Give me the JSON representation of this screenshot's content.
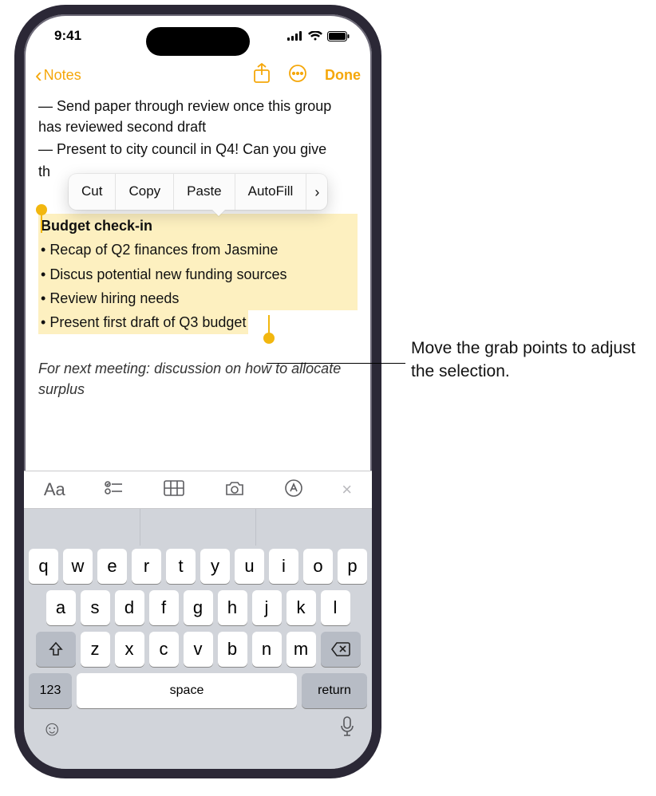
{
  "statusbar": {
    "time": "9:41"
  },
  "nav": {
    "back_label": "Notes",
    "done_label": "Done"
  },
  "note": {
    "line1": "— Send paper through review once this group has reviewed second draft",
    "line2_prefix": "— Present to city council in Q4! Can you give",
    "line2_rest": "th",
    "selection_title": "Budget check-in",
    "sel_items": [
      "Recap of Q2 finances from Jasmine",
      "Discus potential new funding sources",
      "Review hiring needs",
      "Present first draft of Q3 budget"
    ],
    "italic": "For next meeting: discussion on how to allocate surplus"
  },
  "editmenu": {
    "cut": "Cut",
    "copy": "Copy",
    "paste": "Paste",
    "autofill": "AutoFill"
  },
  "keyboard": {
    "row1": [
      "q",
      "w",
      "e",
      "r",
      "t",
      "y",
      "u",
      "i",
      "o",
      "p"
    ],
    "row2": [
      "a",
      "s",
      "d",
      "f",
      "g",
      "h",
      "j",
      "k",
      "l"
    ],
    "row3": [
      "z",
      "x",
      "c",
      "v",
      "b",
      "n",
      "m"
    ],
    "numkey": "123",
    "space": "space",
    "return": "return"
  },
  "callout": {
    "text": "Move the grab points to adjust the selection."
  }
}
